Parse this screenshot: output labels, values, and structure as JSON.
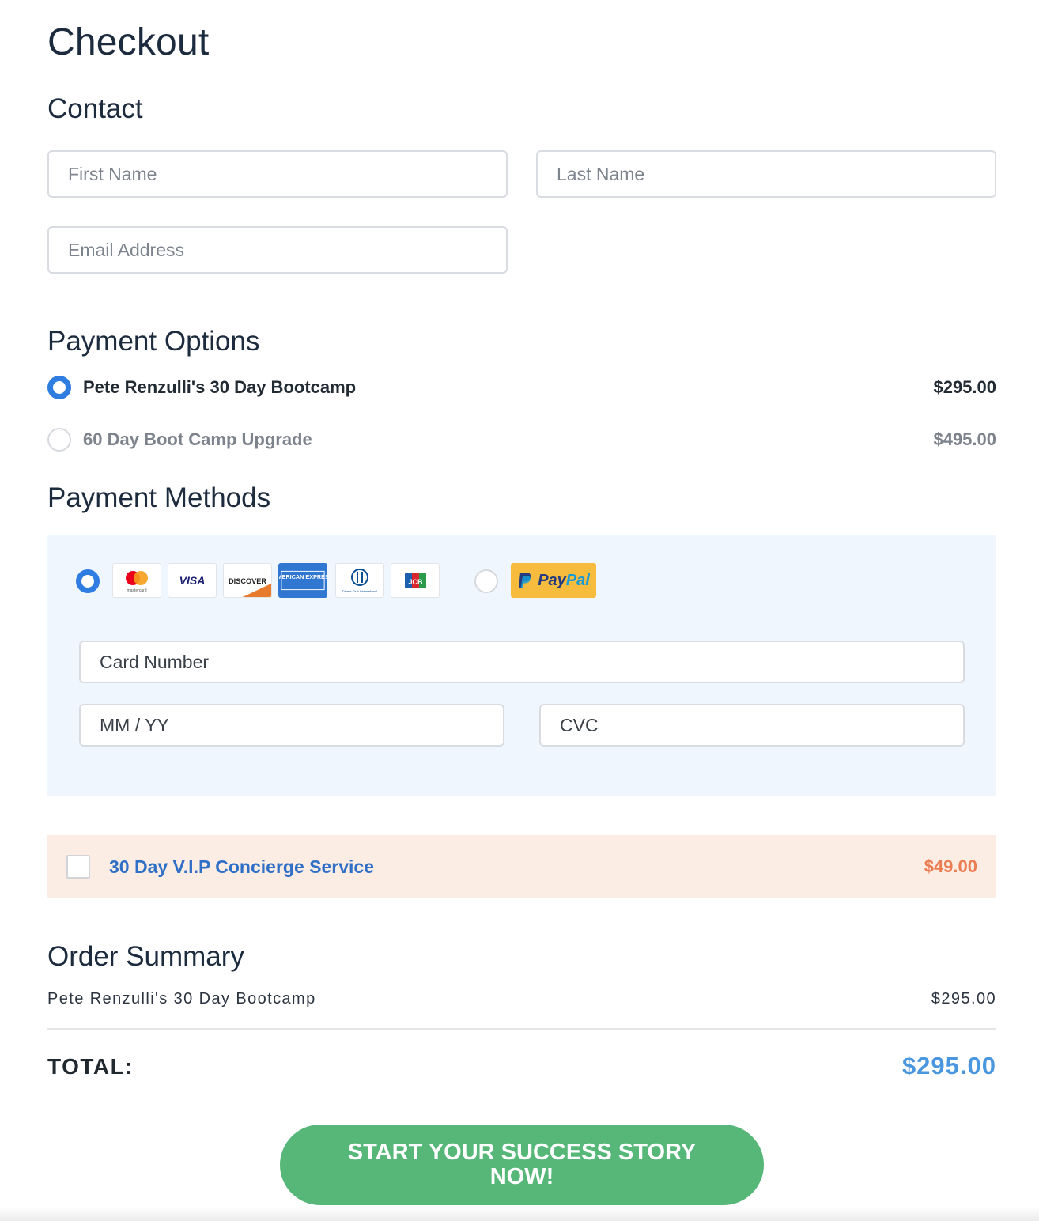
{
  "page": {
    "title": "Checkout"
  },
  "contact": {
    "heading": "Contact",
    "first_name": {
      "value": "",
      "placeholder": "First Name"
    },
    "last_name": {
      "value": "",
      "placeholder": "Last Name"
    },
    "email": {
      "value": "",
      "placeholder": "Email Address"
    }
  },
  "payment_options": {
    "heading": "Payment Options",
    "items": [
      {
        "label": "Pete Renzulli's 30 Day Bootcamp",
        "price": "$295.00",
        "selected": true
      },
      {
        "label": "60 Day Boot Camp Upgrade",
        "price": "$495.00",
        "selected": false
      }
    ]
  },
  "payment_methods": {
    "heading": "Payment Methods",
    "selected_method": "card",
    "card_brands": [
      {
        "icon": "mastercard-icon",
        "text": "mastercard"
      },
      {
        "icon": "visa-icon",
        "text": "VISA"
      },
      {
        "icon": "discover-icon",
        "text": "DISCOVER"
      },
      {
        "icon": "amex-icon",
        "text": "AMERICAN EXPRESS"
      },
      {
        "icon": "diners-club-icon",
        "text": "Diners Club International"
      },
      {
        "icon": "jcb-icon",
        "text": "JCB"
      }
    ],
    "paypal": {
      "icon": "paypal-icon",
      "text_pay": "Pay",
      "text_pal": "Pal"
    },
    "card_number": {
      "value": "",
      "placeholder": "Card Number"
    },
    "expiry": {
      "value": "",
      "placeholder": "MM / YY"
    },
    "cvc": {
      "value": "",
      "placeholder": "CVC"
    }
  },
  "upsell": {
    "label": "30 Day V.I.P Concierge Service",
    "price": "$49.00",
    "checked": false
  },
  "order_summary": {
    "heading": "Order Summary",
    "items": [
      {
        "label": "Pete Renzulli's 30 Day Bootcamp",
        "price": "$295.00"
      }
    ],
    "total_label": "TOTAL:",
    "total_value": "$295.00"
  },
  "cta": {
    "label": "START YOUR SUCCESS STORY NOW!"
  },
  "colors": {
    "accent_blue": "#2f7de1",
    "total_blue": "#4a97e0",
    "cta_green": "#56b779",
    "upsell_bg": "#fbede3",
    "upsell_price": "#ec7d52",
    "methods_bg": "#eff6fd",
    "paypal_yellow": "#f7bb3e"
  }
}
